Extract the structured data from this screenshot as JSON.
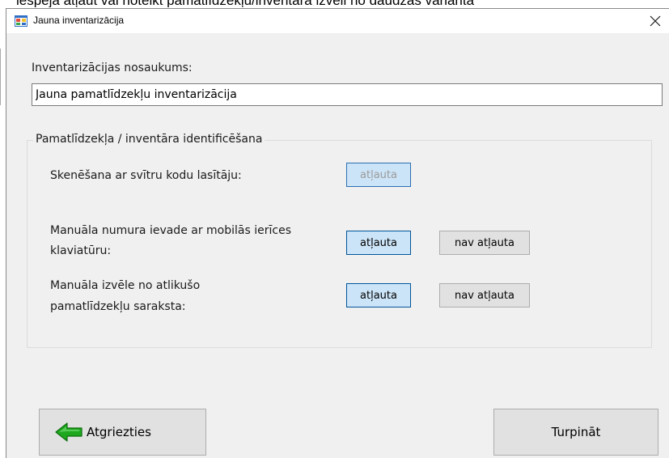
{
  "background_text": "iespēja atļaut vai noteikt pamatlīdzekļu/inventāra izvēli no daudzās varianta",
  "window": {
    "title": "Jauna inventarizācija"
  },
  "name_section": {
    "label": "Inventarizācijas nosaukums:",
    "value": "Jauna pamatlīdzekļu inventarizācija"
  },
  "group": {
    "legend": "Pamatlīdzekļa / inventāra identificēšana",
    "rows": [
      {
        "label": "Skenēšana ar svītru kodu lasītāju:",
        "allowed": "atļauta"
      },
      {
        "label_line1": "Manuāla numura ievade ar mobilās ierīces",
        "label_line2": "klaviatūru:",
        "allowed": "atļauta",
        "not_allowed": "nav atļauta"
      },
      {
        "label_line1": "Manuāla izvēle no atlikušo",
        "label_line2": "pamatlīdzekļu saraksta:",
        "allowed": "atļauta",
        "not_allowed": "nav atļauta"
      }
    ]
  },
  "footer": {
    "back_label": "Atgriezties",
    "continue_label": "Turpināt"
  },
  "colors": {
    "selected_fill": "#cce4f7",
    "selected_border": "#005499",
    "back_arrow": "#1fa81f"
  }
}
